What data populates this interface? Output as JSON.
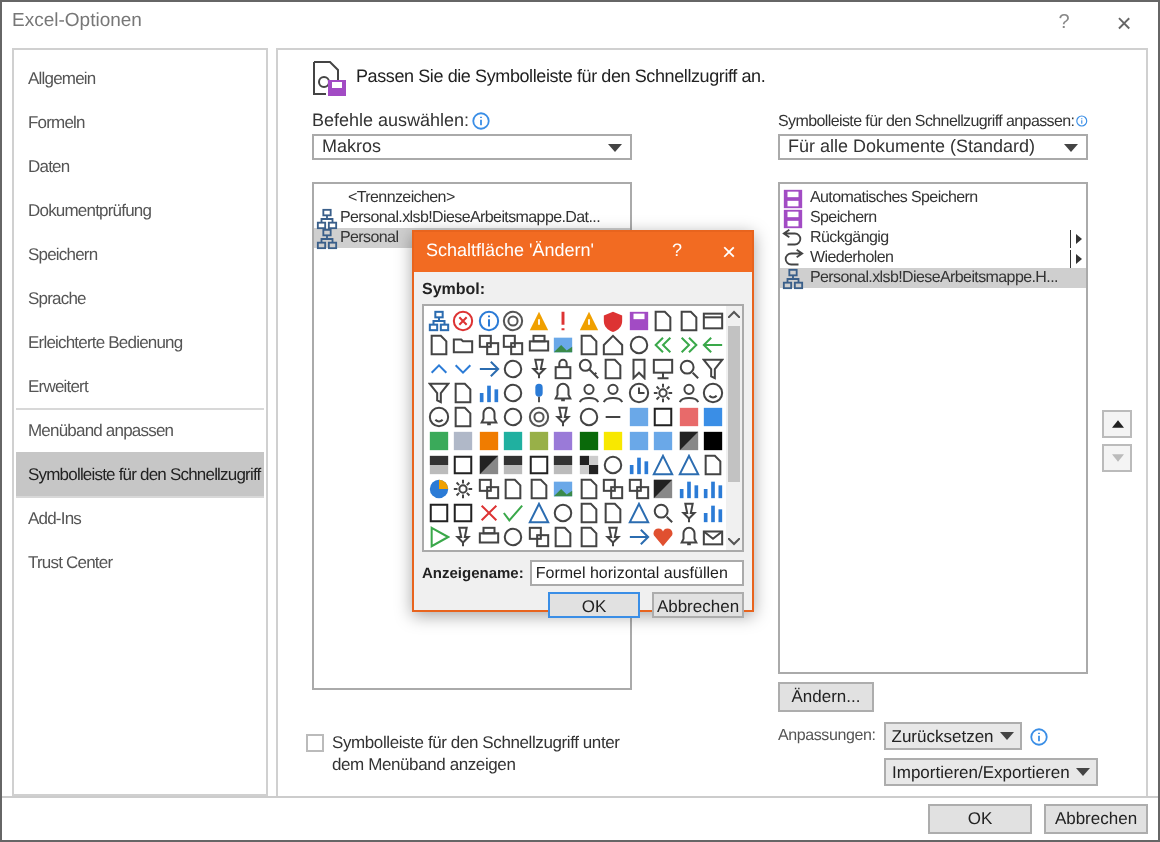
{
  "window": {
    "title": "Excel-Optionen",
    "help": "?",
    "close": "×"
  },
  "sidebar": {
    "items": [
      {
        "label": "Allgemein",
        "selected": false,
        "divider_above": false
      },
      {
        "label": "Formeln",
        "selected": false,
        "divider_above": false
      },
      {
        "label": "Daten",
        "selected": false,
        "divider_above": false
      },
      {
        "label": "Dokumentprüfung",
        "selected": false,
        "divider_above": false
      },
      {
        "label": "Speichern",
        "selected": false,
        "divider_above": false
      },
      {
        "label": "Sprache",
        "selected": false,
        "divider_above": false
      },
      {
        "label": "Erleichterte Bedienung",
        "selected": false,
        "divider_above": false
      },
      {
        "label": "Erweitert",
        "selected": false,
        "divider_above": false
      },
      {
        "label": "Menüband anpassen",
        "selected": false,
        "divider_above": true
      },
      {
        "label": "Symbolleiste für den Schnellzugriff",
        "selected": true,
        "divider_above": false
      },
      {
        "label": "Add-Ins",
        "selected": false,
        "divider_above": true
      },
      {
        "label": "Trust Center",
        "selected": false,
        "divider_above": false
      }
    ]
  },
  "main": {
    "heading": "Passen Sie die Symbolleiste für den Schnellzugriff an.",
    "commands": {
      "label": "Befehle auswählen:",
      "value": "Makros",
      "items": [
        {
          "label": "<Trennzeichen>",
          "kind": "separator",
          "selected": false
        },
        {
          "label": "Personal.xlsb!DieseArbeitsmappe.Dat...",
          "kind": "macro",
          "selected": false
        },
        {
          "label": "Personal",
          "kind": "macro",
          "selected": true
        }
      ]
    },
    "show_below_ribbon": {
      "label": "Symbolleiste für den Schnellzugriff unter dem Menüband anzeigen",
      "checked": false
    },
    "toolbar": {
      "label": "Symbolleiste für den Schnellzugriff anpassen:",
      "value": "Für alle Dokumente (Standard)",
      "items": [
        {
          "label": "Automatisches Speichern",
          "kind": "save",
          "has_submenu": false,
          "selected": false
        },
        {
          "label": "Speichern",
          "kind": "save",
          "has_submenu": false,
          "selected": false
        },
        {
          "label": "Rückgängig",
          "kind": "undo",
          "has_submenu": true,
          "selected": false
        },
        {
          "label": "Wiederholen",
          "kind": "redo",
          "has_submenu": true,
          "selected": false
        },
        {
          "label": "Personal.xlsb!DieseArbeitsmappe.H...",
          "kind": "macro",
          "has_submenu": false,
          "selected": true
        }
      ]
    },
    "move_up": {
      "disabled": false
    },
    "move_down": {
      "disabled": true
    },
    "modify_button": "Ändern...",
    "customizations_label": "Anpassungen:",
    "reset_button": "Zurücksetzen",
    "import_export_button": "Importieren/Exportieren"
  },
  "footer": {
    "ok": "OK",
    "cancel": "Abbrechen"
  },
  "dialog": {
    "title": "Schaltfläche 'Ändern'",
    "help": "?",
    "close": "×",
    "symbol_label": "Symbol:",
    "name_label": "Anzeigename:",
    "name_value": "Formel horizontal ausfüllen",
    "ok": "OK",
    "cancel": "Abbrechen"
  }
}
